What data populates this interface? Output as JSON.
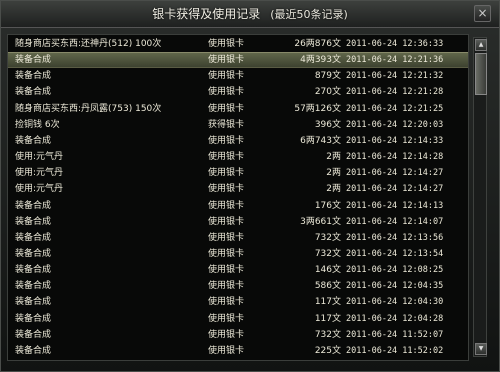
{
  "window": {
    "title": "银卡获得及使用记录",
    "subtitle": "(最近50条记录)",
    "close_label": "×"
  },
  "records": [
    {
      "desc": "随身商店买东西:还神丹(512) 100次",
      "type": "使用银卡",
      "amount": "26两876文",
      "time": "2011-06-24 12:36:33"
    },
    {
      "desc": "装备合成",
      "type": "使用银卡",
      "amount": "4两393文",
      "time": "2011-06-24 12:21:36"
    },
    {
      "desc": "装备合成",
      "type": "使用银卡",
      "amount": "879文",
      "time": "2011-06-24 12:21:32"
    },
    {
      "desc": "装备合成",
      "type": "使用银卡",
      "amount": "270文",
      "time": "2011-06-24 12:21:28"
    },
    {
      "desc": "随身商店买东西:丹凤露(753) 150次",
      "type": "使用银卡",
      "amount": "57两126文",
      "time": "2011-06-24 12:21:25"
    },
    {
      "desc": "捡铜钱 6次",
      "type": "获得银卡",
      "amount": "396文",
      "time": "2011-06-24 12:20:03"
    },
    {
      "desc": "装备合成",
      "type": "使用银卡",
      "amount": "6两743文",
      "time": "2011-06-24 12:14:33"
    },
    {
      "desc": "使用:元气丹",
      "type": "使用银卡",
      "amount": "2两",
      "time": "2011-06-24 12:14:28"
    },
    {
      "desc": "使用:元气丹",
      "type": "使用银卡",
      "amount": "2两",
      "time": "2011-06-24 12:14:27"
    },
    {
      "desc": "使用:元气丹",
      "type": "使用银卡",
      "amount": "2两",
      "time": "2011-06-24 12:14:27"
    },
    {
      "desc": "装备合成",
      "type": "使用银卡",
      "amount": "176文",
      "time": "2011-06-24 12:14:13"
    },
    {
      "desc": "装备合成",
      "type": "使用银卡",
      "amount": "3两661文",
      "time": "2011-06-24 12:14:07"
    },
    {
      "desc": "装备合成",
      "type": "使用银卡",
      "amount": "732文",
      "time": "2011-06-24 12:13:56"
    },
    {
      "desc": "装备合成",
      "type": "使用银卡",
      "amount": "732文",
      "time": "2011-06-24 12:13:54"
    },
    {
      "desc": "装备合成",
      "type": "使用银卡",
      "amount": "146文",
      "time": "2011-06-24 12:08:25"
    },
    {
      "desc": "装备合成",
      "type": "使用银卡",
      "amount": "586文",
      "time": "2011-06-24 12:04:35"
    },
    {
      "desc": "装备合成",
      "type": "使用银卡",
      "amount": "117文",
      "time": "2011-06-24 12:04:30"
    },
    {
      "desc": "装备合成",
      "type": "使用银卡",
      "amount": "117文",
      "time": "2011-06-24 12:04:28"
    },
    {
      "desc": "装备合成",
      "type": "使用银卡",
      "amount": "732文",
      "time": "2011-06-24 11:52:07"
    },
    {
      "desc": "装备合成",
      "type": "使用银卡",
      "amount": "225文",
      "time": "2011-06-24 11:52:02"
    }
  ],
  "selected_row": 1,
  "scroll": {
    "position": 0.0
  }
}
